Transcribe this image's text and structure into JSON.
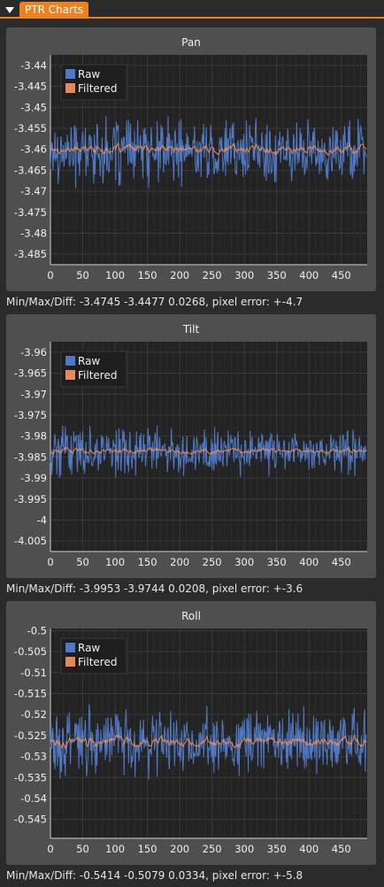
{
  "window": {
    "tab_label": "PTR Charts"
  },
  "colors": {
    "raw": "#4f79c4",
    "filtered": "#e48a5a",
    "tab": "#f07f1e",
    "plot_bg": "#232323",
    "panel": "#4f4f4f"
  },
  "panels": [
    {
      "title": "Pan",
      "status": "Min/Max/Diff: -3.4745 -3.4477  0.0268, pixel error: +-4.7"
    },
    {
      "title": "Tilt",
      "status": "Min/Max/Diff: -3.9953 -3.9744  0.0208, pixel error: +-3.6"
    },
    {
      "title": "Roll",
      "status": "Min/Max/Diff: -0.5414 -0.5079  0.0334, pixel error: +-5.8"
    }
  ],
  "chart_data": [
    {
      "type": "line",
      "title": "Pan",
      "xlim": [
        0,
        490
      ],
      "ylim": [
        -3.4875,
        -3.4375
      ],
      "xticks": [
        "0",
        "50",
        "100",
        "150",
        "200",
        "250",
        "300",
        "350",
        "400",
        "450"
      ],
      "yticks": [
        "-3.44",
        "-3.445",
        "-3.45",
        "-3.455",
        "-3.46",
        "-3.465",
        "-3.47",
        "-3.475",
        "-3.48",
        "-3.485"
      ],
      "legend": "top-left",
      "grid": true,
      "series": [
        {
          "name": "Raw",
          "center": -3.4605,
          "spread": 0.0072,
          "min": -3.4745,
          "max": -3.4477
        },
        {
          "name": "Filtered",
          "center": -3.46,
          "spread": 0.0014
        }
      ]
    },
    {
      "type": "line",
      "title": "Tilt",
      "xlim": [
        0,
        490
      ],
      "ylim": [
        -4.0075,
        -3.9575
      ],
      "xticks": [
        "0",
        "50",
        "100",
        "150",
        "200",
        "250",
        "300",
        "350",
        "400",
        "450"
      ],
      "yticks": [
        "-3.96",
        "-3.965",
        "-3.97",
        "-3.975",
        "-3.98",
        "-3.985",
        "-3.99",
        "-3.995",
        "-4",
        "-4.005"
      ],
      "legend": "top-left",
      "grid": true,
      "series": [
        {
          "name": "Raw",
          "center": -3.9835,
          "spread": 0.0052,
          "min": -3.9953,
          "max": -3.9744
        },
        {
          "name": "Filtered",
          "center": -3.9835,
          "spread": 0.0009
        }
      ]
    },
    {
      "type": "line",
      "title": "Roll",
      "xlim": [
        0,
        490
      ],
      "ylim": [
        -0.5495,
        -0.4995
      ],
      "xticks": [
        "0",
        "50",
        "100",
        "150",
        "200",
        "250",
        "300",
        "350",
        "400",
        "450"
      ],
      "yticks": [
        "-0.5",
        "-0.505",
        "-0.51",
        "-0.515",
        "-0.52",
        "-0.525",
        "-0.53",
        "-0.535",
        "-0.54",
        "-0.545"
      ],
      "legend": "top-left",
      "grid": true,
      "series": [
        {
          "name": "Raw",
          "center": -0.5265,
          "spread": 0.0072,
          "min": -0.5414,
          "max": -0.5079
        },
        {
          "name": "Filtered",
          "center": -0.5265,
          "spread": 0.0016
        }
      ]
    }
  ]
}
